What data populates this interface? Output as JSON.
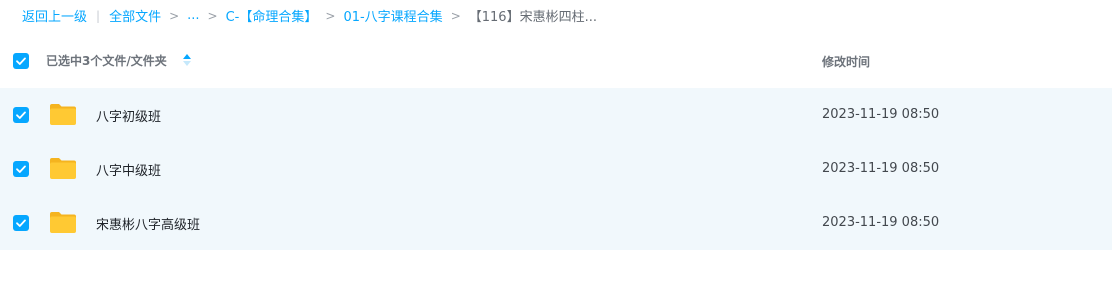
{
  "breadcrumb": {
    "back": "返回上一级",
    "all_files": "全部文件",
    "ellipsis": "...",
    "crumbs": [
      "C-【命理合集】",
      "01-八字课程合集"
    ],
    "current": "【116】宋惠彬四柱..."
  },
  "header": {
    "selected_label": "已选中3个文件/文件夹",
    "modified_label": "修改时间"
  },
  "files": [
    {
      "name": "八字初级班",
      "modified": "2023-11-19 08:50",
      "checked": true
    },
    {
      "name": "八字中级班",
      "modified": "2023-11-19 08:50",
      "checked": true
    },
    {
      "name": "宋惠彬八字高级班",
      "modified": "2023-11-19 08:50",
      "checked": true
    }
  ],
  "colors": {
    "accent": "#06a7ff",
    "folder": "#ffc933",
    "selected_row_bg": "#f1f8fc"
  },
  "icons": {
    "checkbox": "checkmark-icon",
    "folder": "folder-icon",
    "sort": "sort-icon"
  }
}
